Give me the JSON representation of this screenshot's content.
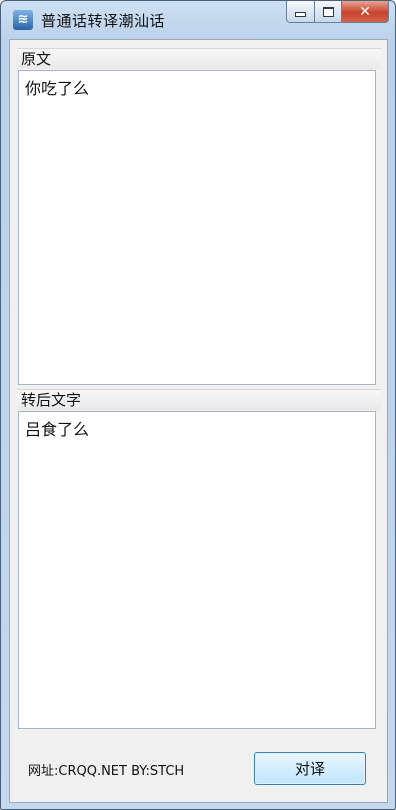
{
  "window": {
    "title": "普通话转译潮汕话",
    "icon": "app-icon"
  },
  "caption_buttons": {
    "close_glyph": "✕"
  },
  "source": {
    "header": "原文",
    "text": "你吃了么"
  },
  "result": {
    "header": "转后文字",
    "text": "吕食了么"
  },
  "footer": {
    "info": "网址:CRQQ.NET BY:STCH",
    "translate_button": "对译"
  },
  "colors": {
    "close_button": "#c7432b",
    "title_bar": "#b9d1ea",
    "button_accent": "#3c7fb1"
  }
}
